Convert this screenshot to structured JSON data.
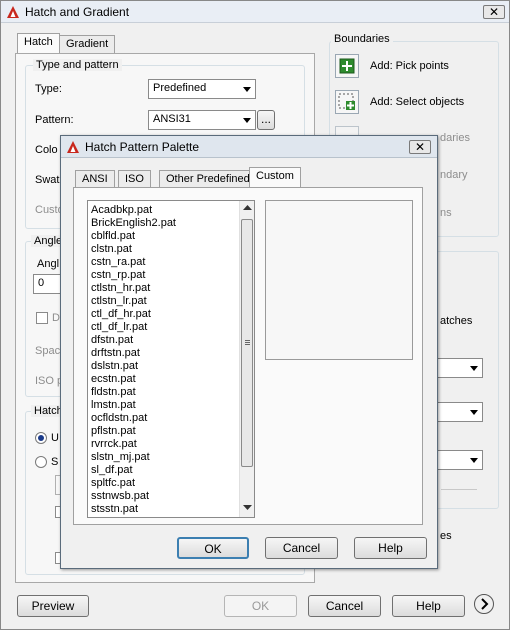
{
  "main": {
    "title": "Hatch and Gradient",
    "close_label": "✕",
    "tabs": [
      "Hatch",
      "Gradient"
    ],
    "type_pattern": {
      "legend": "Type and pattern",
      "type_label": "Type:",
      "type_value": "Predefined",
      "pattern_label": "Pattern:",
      "pattern_value": "ANSI31",
      "ellipsis": "...",
      "color_label_partial": "Colo",
      "swatch_label_partial": "Swat",
      "custom_label_partial": "Custo"
    },
    "angle": {
      "legend_partial": "Angle",
      "angle_label_partial": "Angl",
      "angle_value_partial": "0",
      "double_partial": "D",
      "spacing_partial": "Spac",
      "iso_partial": "ISO p"
    },
    "hatch_origin": {
      "legend_partial": "Hatch",
      "opt1_partial": "U",
      "opt2_partial": "S"
    },
    "boundaries": {
      "legend": "Boundaries",
      "add_pick_points": "Add: Pick points",
      "add_select_objects": "Add: Select objects",
      "remove_boundaries_partial": "daries",
      "recreate_boundary_partial": "ndary",
      "view_selections_partial": "ns"
    },
    "options": {
      "separate_hatches_partial": "atches",
      "annotative_partial": "es"
    },
    "footer": {
      "preview": "Preview",
      "ok": "OK",
      "cancel": "Cancel",
      "help": "Help",
      "more_icon": "chevron-right-icon"
    }
  },
  "palette": {
    "title": "Hatch Pattern Palette",
    "close_label": "✕",
    "tabs": [
      "ANSI",
      "ISO",
      "Other Predefined",
      "Custom"
    ],
    "active_tab": "Custom",
    "patterns": [
      "Acadbkp.pat",
      "BrickEnglish2.pat",
      "cblfld.pat",
      "clstn.pat",
      "cstn_ra.pat",
      "cstn_rp.pat",
      "ctlstn_hr.pat",
      "ctlstn_lr.pat",
      "ctl_df_hr.pat",
      "ctl_df_lr.pat",
      "dfstn.pat",
      "drftstn.pat",
      "dslstn.pat",
      "ecstn.pat",
      "fldstn.pat",
      "lmstn.pat",
      "ocfldstn.pat",
      "pflstn.pat",
      "rvrrck.pat",
      "slstn_mj.pat",
      "sl_df.pat",
      "spltfc.pat",
      "sstnwsb.pat",
      "stsstn.pat"
    ],
    "buttons": {
      "ok": "OK",
      "cancel": "Cancel",
      "help": "Help"
    }
  },
  "colors": {
    "accent_red": "#c8281e",
    "pick_green": "#2e8b2e"
  }
}
